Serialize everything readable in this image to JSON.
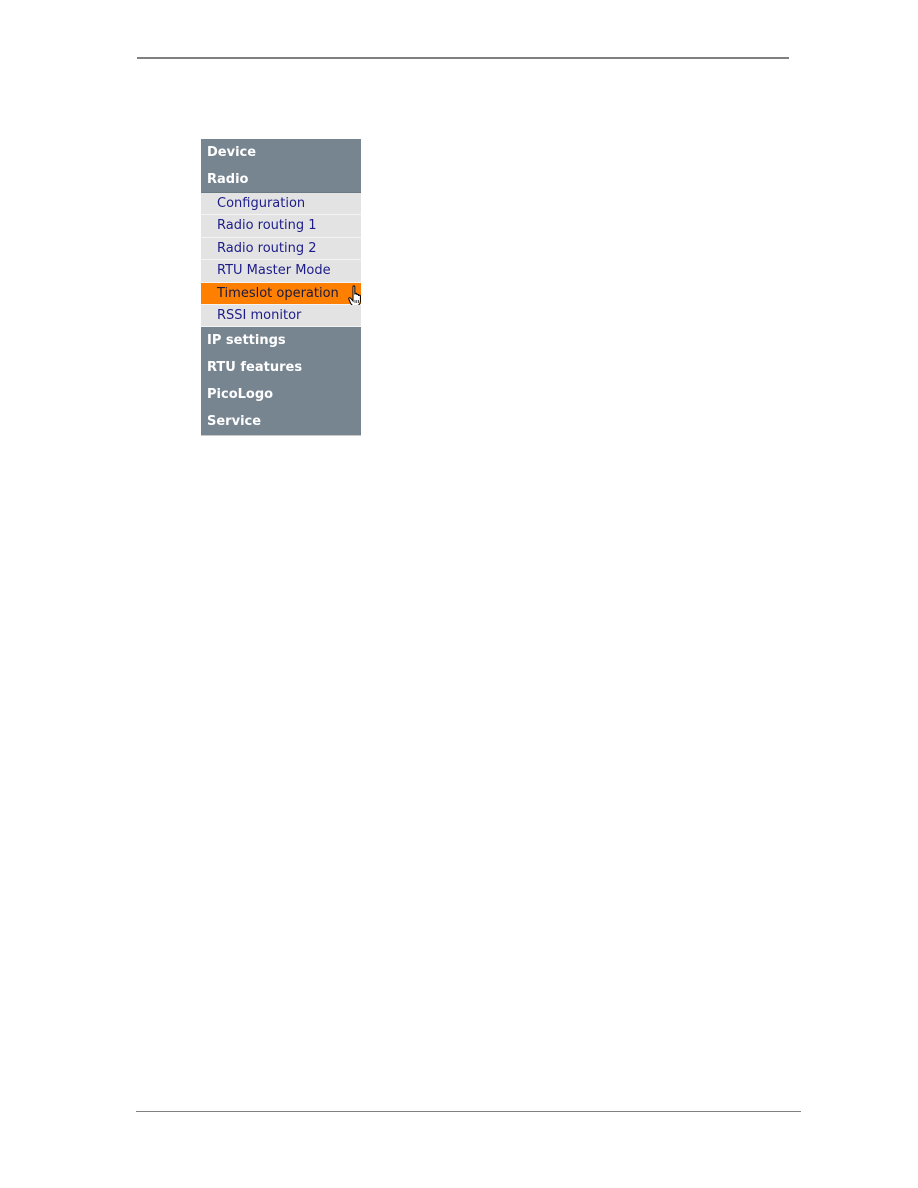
{
  "menu": {
    "top_items_before": [
      {
        "label": "Device"
      },
      {
        "label": "Radio"
      }
    ],
    "radio_submenu": [
      {
        "label": "Configuration",
        "active": false
      },
      {
        "label": "Radio routing 1",
        "active": false
      },
      {
        "label": "Radio routing 2",
        "active": false
      },
      {
        "label": "RTU Master Mode",
        "active": false
      },
      {
        "label": "Timeslot operation",
        "active": true
      },
      {
        "label": "RSSI monitor",
        "active": false
      }
    ],
    "top_items_after": [
      {
        "label": "IP settings"
      },
      {
        "label": "RTU features"
      },
      {
        "label": "PicoLogo"
      },
      {
        "label": "Service"
      }
    ],
    "colors": {
      "section_bg": "#778591",
      "submenu_bg": "#e3e3e3",
      "active_bg": "#ff7f00",
      "link_text": "#1d1d8a"
    }
  },
  "cursor": {
    "icon": "hand-pointer-icon"
  }
}
